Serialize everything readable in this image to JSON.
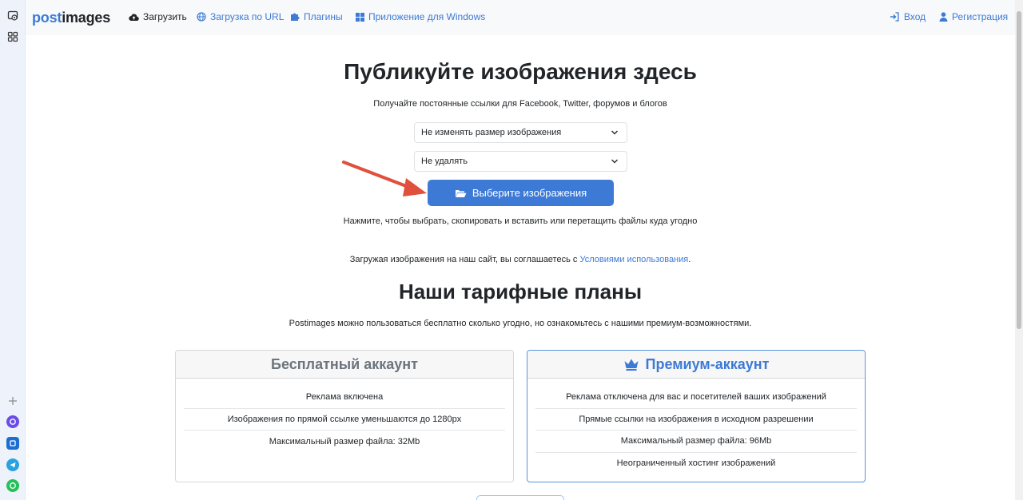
{
  "nav": {
    "logo_part1": "post",
    "logo_part2": "images",
    "upload": "Загрузить",
    "url_upload": "Загрузка по URL",
    "plugins": "Плагины",
    "windows_app": "Приложение для Windows",
    "login": "Вход",
    "register": "Регистрация"
  },
  "hero": {
    "title": "Публикуйте изображения здесь",
    "subtitle": "Получайте постоянные ссылки для Facebook, Twitter, форумов и блогов",
    "resize_select": "Не изменять размер изображения",
    "expire_select": "Не удалять",
    "choose_button": "Выберите изображения",
    "hint": "Нажмите, чтобы выбрать, скопировать и вставить или перетащить файлы куда угодно",
    "terms_prefix": "Загружая изображения на наш сайт, вы соглашаетесь с ",
    "terms_link": "Условиями использования",
    "terms_suffix": "."
  },
  "plans": {
    "title": "Наши тарифные планы",
    "subtitle": "Postimages можно пользоваться бесплатно сколько угодно, но ознакомьтесь с нашими премиум-возможностями.",
    "free": {
      "title": "Бесплатный аккаунт",
      "features": [
        "Реклама включена",
        "Изображения по прямой ссылке уменьшаются до 1280px",
        "Максимальный размер файла: 32Mb"
      ]
    },
    "premium": {
      "title": "Премиум-аккаунт",
      "features": [
        "Реклама отключена для вас и посетителей ваших изображений",
        "Прямые ссылки на изображения в исходном разрешении",
        "Максимальный размер файла: 96Mb",
        "Неограниченный хостинг изображений"
      ]
    }
  },
  "colors": {
    "accent": "#3d7ad6",
    "arrow": "#e0503d",
    "sidebar_bg": "#eef2fa"
  },
  "icons": {
    "sidebar_top": [
      "screenshot-icon",
      "apps-grid-icon"
    ],
    "sidebar_bottom": [
      "add-icon",
      "messenger-icon",
      "outlook-icon",
      "telegram-icon",
      "whatsapp-icon"
    ]
  }
}
